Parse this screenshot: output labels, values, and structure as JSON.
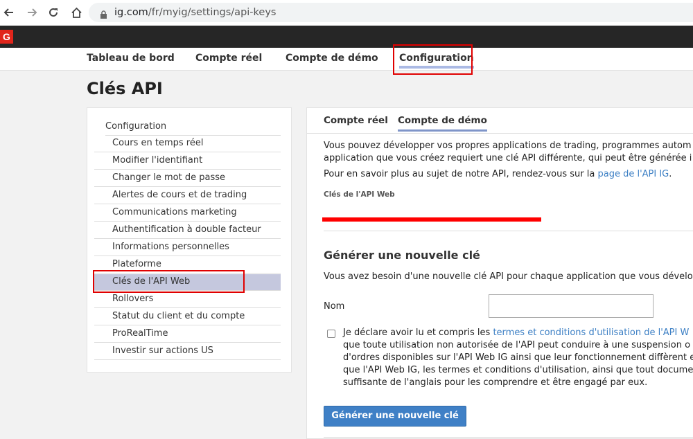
{
  "browser": {
    "url_host": "ig.com",
    "url_path": "/fr/myig/settings/api-keys"
  },
  "logo": {
    "text": "G"
  },
  "main_nav": {
    "items": [
      "Tableau de bord",
      "Compte réel",
      "Compte de démo",
      "Configuration"
    ],
    "active": "Configuration"
  },
  "page": {
    "title": "Clés API"
  },
  "sidebar": {
    "heading": "Configuration",
    "items": [
      "Cours en temps réel",
      "Modifier l'identifiant",
      "Changer le mot de passe",
      "Alertes de cours et de trading",
      "Communications marketing",
      "Authentification à double facteur",
      "Informations personnelles",
      "Plateforme",
      "Clés de l'API Web",
      "Rollovers",
      "Statut du client et du compte",
      "ProRealTime",
      "Investir sur actions US"
    ],
    "active": "Clés de l'API Web"
  },
  "content": {
    "tabs": [
      "Compte réel",
      "Compte de démo"
    ],
    "active_tab": "Compte de démo",
    "intro_line1": "Vous pouvez développer vos propres applications de trading, programmes autom",
    "intro_line2": "application que vous créez requiert une clé API différente, qui peut être générée i",
    "more_info_prefix": "Pour en savoir plus au sujet de notre API, rendez-vous sur la ",
    "more_info_link": "page de l'API IG",
    "more_info_suffix": ".",
    "keys_label": "Clés de l'API Web",
    "generate_heading": "Générer une nouvelle clé",
    "generate_desc": "Vous avez besoin d'une nouvelle clé API pour chaque application que vous dévelo",
    "name_label": "Nom",
    "name_value": "",
    "declaration_prefix": "Je déclare avoir lu et compris les ",
    "declaration_link": "termes et conditions d'utilisation de l'API W",
    "declaration_line2": "que toute utilisation non autorisée de l'API peut conduire à une suspension o",
    "declaration_line3": "d'ordres disponibles sur l'API Web IG ainsi que leur fonctionnement diffèrent e",
    "declaration_line4": "que l'API Web IG, les termes et conditions d'utilisation, ainsi que tout docume",
    "declaration_line5": "suffisante de l'anglais pour les comprendre et être engagé par eux.",
    "generate_button": "Générer une nouvelle clé"
  },
  "colors": {
    "highlight_box": "#e00000",
    "accent_blue": "#3f80c6",
    "sidebar_active": "#c5c8de"
  }
}
